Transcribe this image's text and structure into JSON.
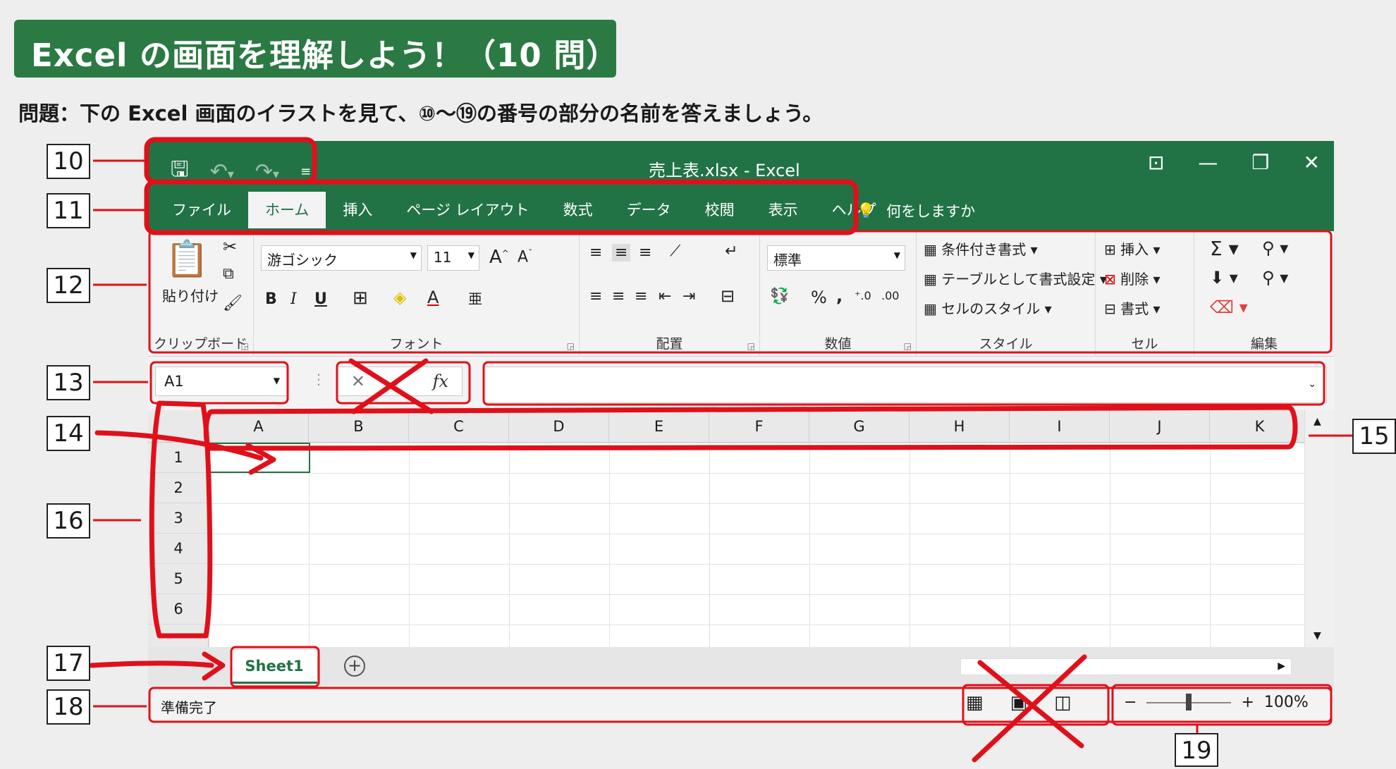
{
  "heading": {
    "title": "Excel の画面を理解しよう！（10 問）",
    "question": "問題：下の Excel 画面のイラストを見て、⑩～⑲の番号の部分の名前を答えましょう。"
  },
  "window": {
    "title": "売上表.xlsx - Excel",
    "tabs": [
      "ファイル",
      "ホーム",
      "挿入",
      "ページ レイアウト",
      "数式",
      "データ",
      "校閲",
      "表示",
      "ヘルプ"
    ],
    "active_tab": "ホーム",
    "tell_me": "何をしますか"
  },
  "ribbon": {
    "clipboard": {
      "paste": "貼り付け",
      "label": "クリップボード"
    },
    "font": {
      "name": "游ゴシック",
      "size": "11",
      "label": "フォント"
    },
    "alignment": {
      "label": "配置"
    },
    "number": {
      "format": "標準",
      "label": "数値",
      "percent": "%",
      "comma": ","
    },
    "styles": {
      "conditional": "条件付き書式",
      "table": "テーブルとして書式設定",
      "cell_styles": "セルのスタイル",
      "label": "スタイル"
    },
    "cells": {
      "insert": "挿入",
      "delete": "削除",
      "format": "書式",
      "label": "セル"
    },
    "editing": {
      "label": "編集"
    }
  },
  "formula_bar": {
    "name_box": "A1",
    "fx": "fx"
  },
  "grid": {
    "columns": [
      "A",
      "B",
      "C",
      "D",
      "E",
      "F",
      "G",
      "H",
      "I",
      "J",
      "K"
    ],
    "rows": [
      "1",
      "2",
      "3",
      "4",
      "5",
      "6"
    ]
  },
  "sheets": {
    "active": "Sheet1"
  },
  "status": {
    "text": "準備完了",
    "zoom": "100%",
    "zoom_value": 100
  },
  "callouts": [
    "10",
    "11",
    "12",
    "13",
    "14",
    "15",
    "16",
    "17",
    "18",
    "19"
  ],
  "colors": {
    "excel_green": "#217346",
    "banner_green": "#2b7a43",
    "annotation_red": "#e0101a"
  }
}
